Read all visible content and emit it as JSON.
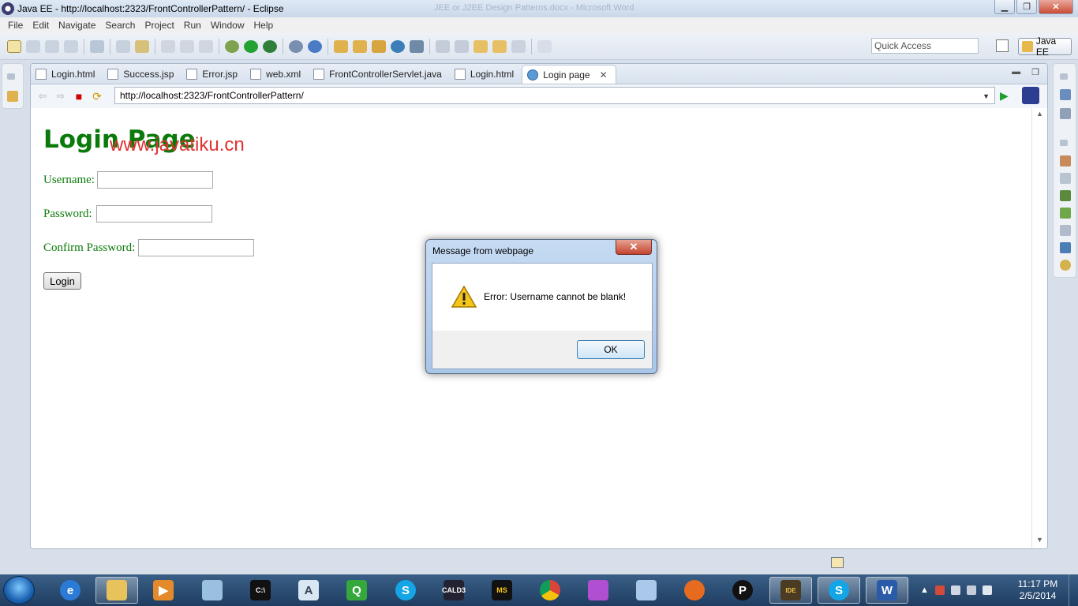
{
  "window": {
    "title": "Java EE - http://localhost:2323/FrontControllerPattern/ - Eclipse",
    "ghost_title": "JEE or J2EE Design Patterns.docx - Microsoft Word"
  },
  "menu": [
    "File",
    "Edit",
    "Navigate",
    "Search",
    "Project",
    "Run",
    "Window",
    "Help"
  ],
  "toolbar": {
    "quick_access_placeholder": "Quick Access",
    "perspective_label": "Java EE"
  },
  "editor_tabs": [
    {
      "label": "Login.html",
      "icon": "html-file-icon"
    },
    {
      "label": "Success.jsp",
      "icon": "jsp-file-icon"
    },
    {
      "label": "Error.jsp",
      "icon": "jsp-file-icon"
    },
    {
      "label": "web.xml",
      "icon": "xml-file-icon"
    },
    {
      "label": "FrontControllerServlet.java",
      "icon": "java-file-icon"
    },
    {
      "label": "Login.html",
      "icon": "html-file-icon"
    },
    {
      "label": "Login page",
      "icon": "globe-icon",
      "active": true
    }
  ],
  "browser": {
    "url": "http://localhost:2323/FrontControllerPattern/"
  },
  "page": {
    "heading": "Login Page",
    "watermark": "www.javatiku.cn",
    "username_label": "Username:",
    "password_label": "Password:",
    "confirm_label": "Confirm Password:",
    "login_button": "Login"
  },
  "dialog": {
    "title": "Message from webpage",
    "message": "Error: Username cannot be blank!",
    "ok_label": "OK"
  },
  "taskbar": {
    "clock_time": "11:17 PM",
    "clock_date": "2/5/2014",
    "apps": [
      "internet-explorer-icon",
      "file-explorer-icon",
      "media-player-icon",
      "notepad-icon",
      "cmd-icon",
      "wordpad-icon",
      "green-app-icon",
      "skype-icon",
      "cald3-icon",
      "ms-tools-icon",
      "chrome-icon",
      "pen-tool-icon",
      "virtualbox-icon",
      "firefox-icon",
      "p-app-icon",
      "java-ee-ide-icon",
      "skype-running-icon",
      "word-icon"
    ]
  }
}
